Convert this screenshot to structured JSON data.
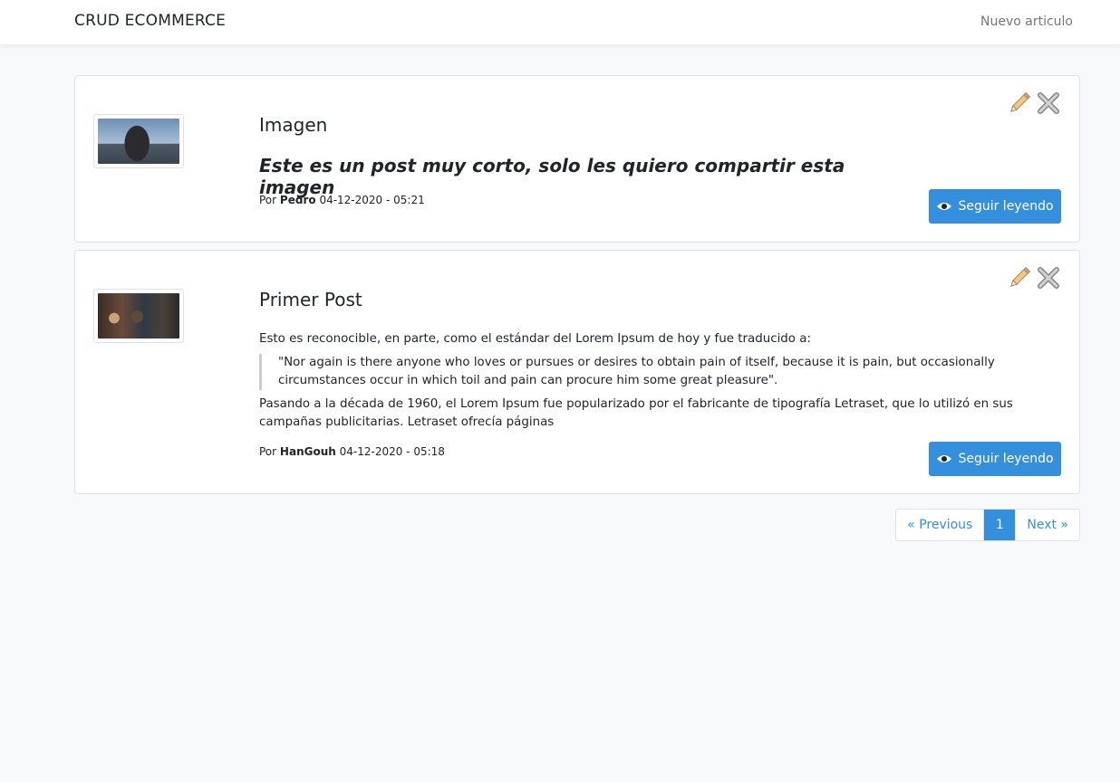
{
  "navbar": {
    "brand": "CRUD ECOMMERCE",
    "new_article": "Nuevo articulo"
  },
  "posts": [
    {
      "title": "Imagen",
      "lead": "Este es un post muy corto, solo les quiero compartir esta imagen",
      "meta_prefix": "Por",
      "author": "Pedro",
      "date": "04-12-2020 - 05:21",
      "button": "Seguir leyendo"
    },
    {
      "title": "Primer Post",
      "paragraph1": "Esto es reconocible, en parte, como el estándar del Lorem Ipsum de hoy y fue traducido a:",
      "quote": "\"Nor again is there anyone who loves or pursues or desires to obtain pain of itself, because it is pain, but occasionally circumstances occur in which toil and pain can procure him some great pleasure\".",
      "paragraph2": "Pasando a la década de 1960, el Lorem Ipsum fue popularizado por el fabricante de tipografía Letraset, que lo utilizó en sus campañas publicitarias. Letraset ofrecía páginas",
      "meta_prefix": "Por",
      "author": "HanGouh",
      "date": "04-12-2020 - 05:18",
      "button": "Seguir leyendo"
    }
  ],
  "pagination": {
    "previous": "« Previous",
    "current": "1",
    "next": "Next »"
  },
  "colors": {
    "primary": "#3490dc",
    "background": "#f8f9fa"
  }
}
